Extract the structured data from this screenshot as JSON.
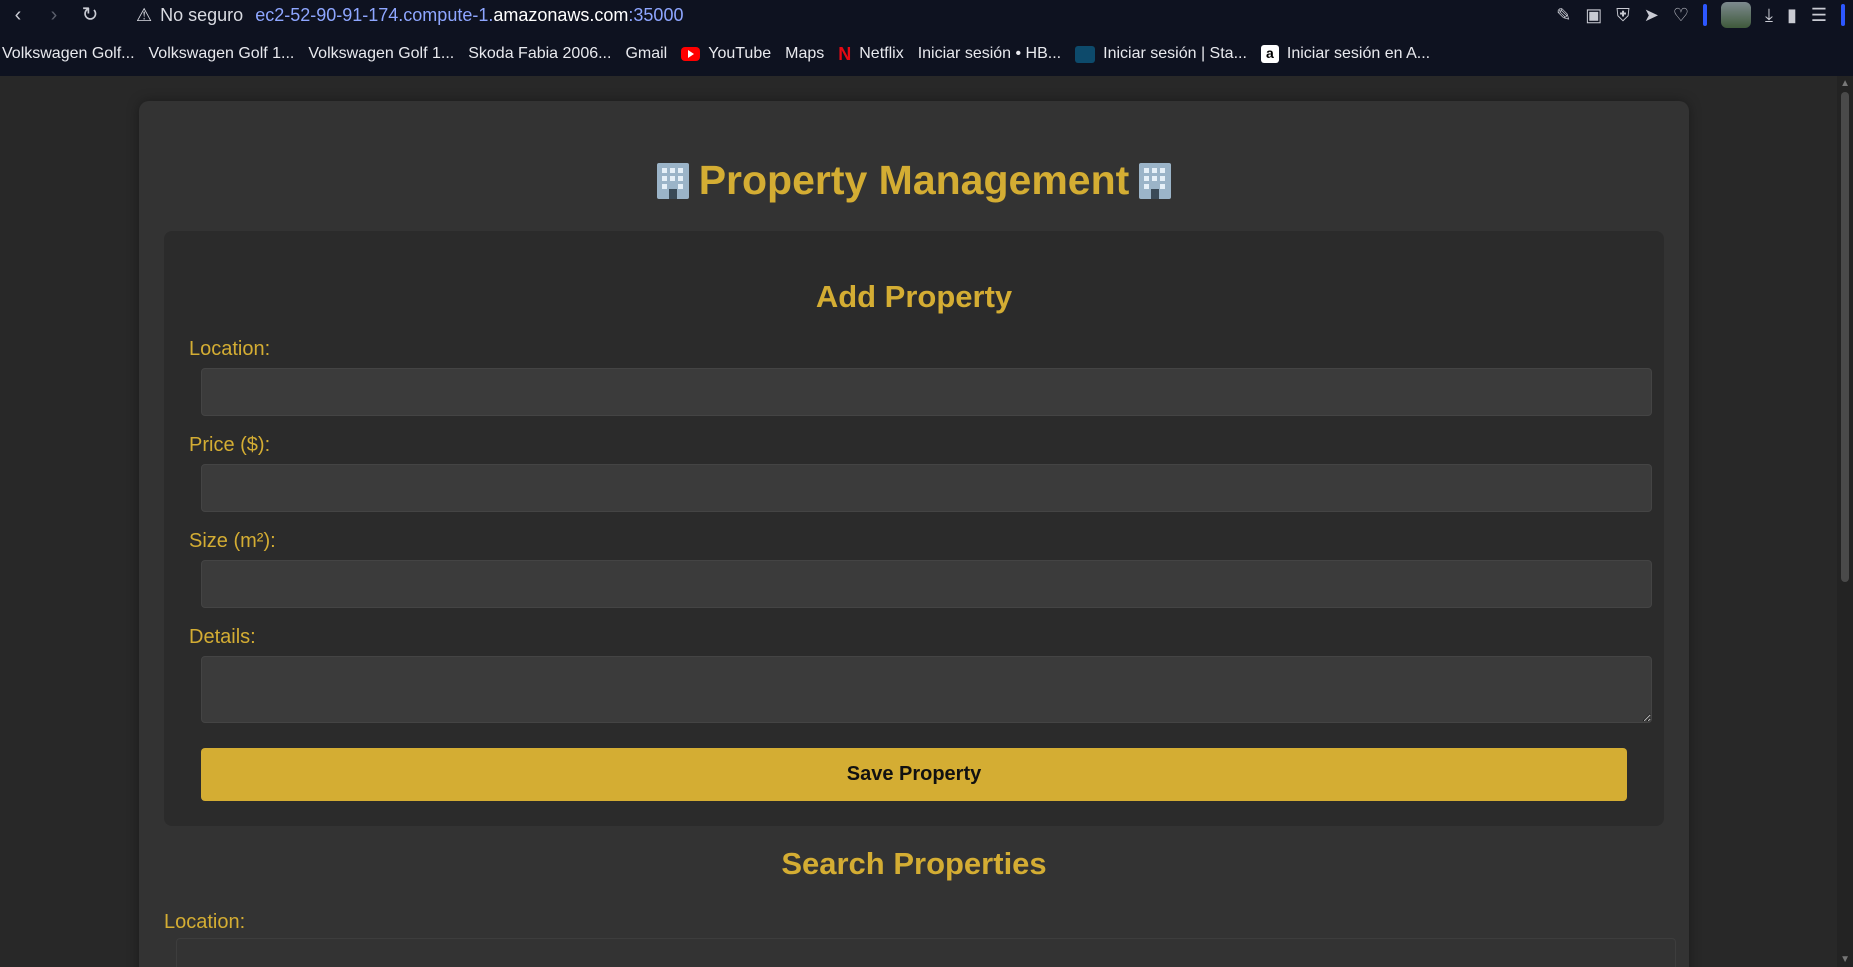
{
  "browser": {
    "security_label": "No seguro",
    "url_prefix": "ec2-52-90-91-174.compute-1.",
    "url_host": "amazonaws.com",
    "url_port": ":35000",
    "bookmarks": [
      {
        "label": "Volkswagen Golf...",
        "icon": "page-icon"
      },
      {
        "label": "Volkswagen Golf 1...",
        "icon": "page-icon"
      },
      {
        "label": "Volkswagen Golf 1...",
        "icon": "page-icon"
      },
      {
        "label": "Skoda Fabia 2006...",
        "icon": "page-icon"
      },
      {
        "label": "Gmail",
        "icon": "page-icon"
      },
      {
        "label": "YouTube",
        "icon": "youtube-icon"
      },
      {
        "label": "Maps",
        "icon": "page-icon"
      },
      {
        "label": "Netflix",
        "icon": "netflix-icon"
      },
      {
        "label": "Iniciar sesión • HB...",
        "icon": "page-icon"
      },
      {
        "label": "Iniciar sesión | Sta...",
        "icon": "star-plus-icon"
      },
      {
        "label": "Iniciar sesión en A...",
        "icon": "amazon-icon"
      }
    ]
  },
  "page": {
    "title": "Property Management",
    "title_icon": "office-building-icon",
    "add_form": {
      "heading": "Add Property",
      "location_label": "Location:",
      "location_value": "",
      "price_label": "Price ($):",
      "price_value": "",
      "size_label": "Size (m²):",
      "size_value": "",
      "details_label": "Details:",
      "details_value": "",
      "save_label": "Save Property"
    },
    "search": {
      "heading": "Search Properties",
      "location_label": "Location:"
    }
  },
  "colors": {
    "accent": "#d4ad33",
    "background": "#282828",
    "panel": "#333333",
    "card": "#2b2b2b",
    "input": "#3b3b3b"
  }
}
